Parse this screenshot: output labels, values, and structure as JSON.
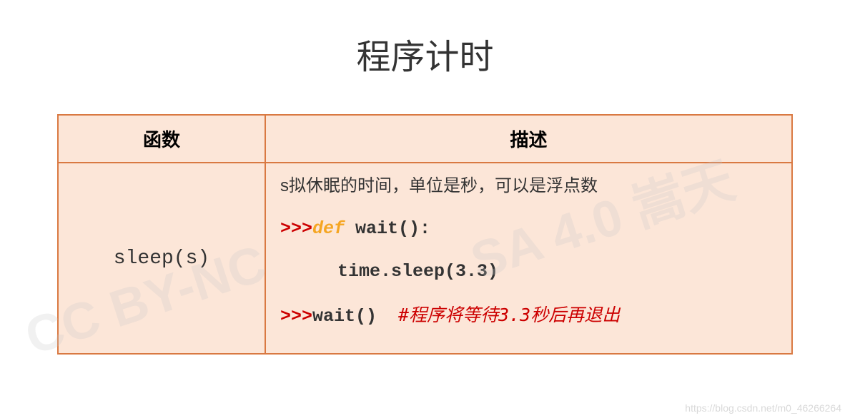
{
  "title": "程序计时",
  "headers": {
    "func": "函数",
    "desc": "描述"
  },
  "row": {
    "function_name": "sleep(s)",
    "description": "s拟休眠的时间，单位是秒，可以是浮点数",
    "code": {
      "prompt": ">>>",
      "def_keyword": "def",
      "def_rest": " wait():",
      "body": "time.sleep(3.3)",
      "call": "wait()",
      "comment": "#程序将等待3.3秒后再退出"
    }
  },
  "watermark": {
    "wm1": "SA 4.0 嵩天",
    "wm2": "CC BY-NC",
    "small": "https://blog.csdn.net/m0_46266264"
  }
}
